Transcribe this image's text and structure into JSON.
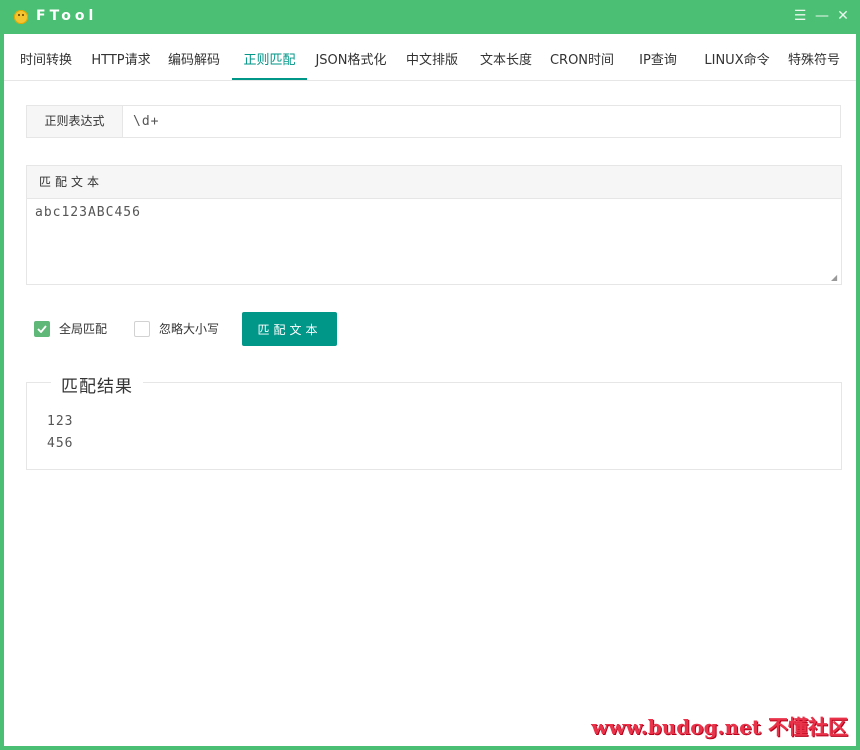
{
  "app": {
    "title": "FTool"
  },
  "tabs": [
    {
      "label": "时间转换"
    },
    {
      "label": "HTTP请求"
    },
    {
      "label": "编码解码"
    },
    {
      "label": "正则匹配",
      "active": true
    },
    {
      "label": "JSON格式化"
    },
    {
      "label": "中文排版"
    },
    {
      "label": "文本长度"
    },
    {
      "label": "CRON时间"
    },
    {
      "label": "IP查询"
    },
    {
      "label": "LINUX命令"
    },
    {
      "label": "特殊符号"
    }
  ],
  "regex": {
    "label": "正则表达式",
    "value": "\\d+"
  },
  "text": {
    "header": "匹配文本",
    "value": "abc123ABC456"
  },
  "options": {
    "global": {
      "label": "全局匹配",
      "checked": true
    },
    "ignore_case": {
      "label": "忽略大小写",
      "checked": false
    }
  },
  "match_button": "匹配文本",
  "result": {
    "legend": "匹配结果",
    "lines": [
      "123",
      "456"
    ]
  },
  "watermark": "www.budog.net 不懂社区",
  "colors": {
    "titlebar": "#4bbf73",
    "accent": "#009688",
    "checkbox": "#5fb878"
  }
}
